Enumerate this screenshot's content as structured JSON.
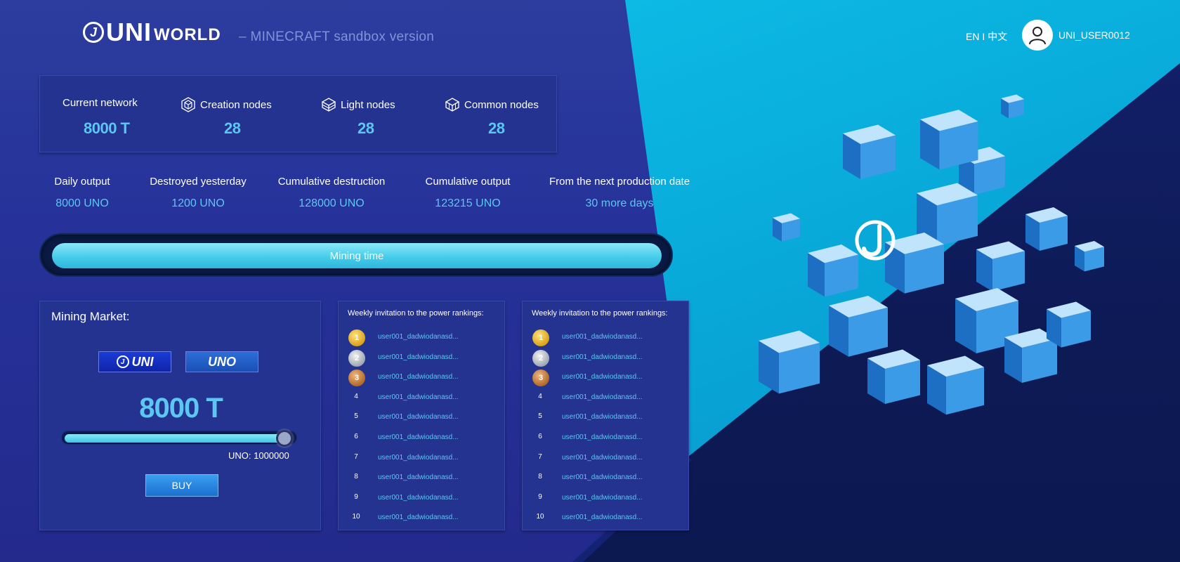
{
  "header": {
    "logo_uni": "UNI",
    "logo_world": "WORLD",
    "subtitle": "– MINECRAFT sandbox version",
    "lang_toggle": "EN I 中文",
    "username": "UNI_USER0012"
  },
  "network": [
    {
      "label": "Current network",
      "value": "8000 T",
      "icon": ""
    },
    {
      "label": "Creation nodes",
      "value": "28",
      "icon": "hexagon-cube-icon"
    },
    {
      "label": "Light nodes",
      "value": "28",
      "icon": "layered-cube-icon"
    },
    {
      "label": "Common nodes",
      "value": "28",
      "icon": "cube-icon"
    }
  ],
  "stats": [
    {
      "label": "Daily output",
      "value": "8000 UNO"
    },
    {
      "label": "Destroyed yesterday",
      "value": "1200 UNO"
    },
    {
      "label": "Cumulative destruction",
      "value": "128000 UNO"
    },
    {
      "label": "Cumulative output",
      "value": "123215 UNO"
    },
    {
      "label": "From the next production date",
      "value": "30 more days"
    }
  ],
  "mining_time": {
    "label": "Mining time"
  },
  "market": {
    "title": "Mining Market:",
    "token_uni": "UNI",
    "token_uno": "UNO",
    "amount": "8000 T",
    "slider_fraction": 0.98,
    "balance": "UNO: 1000000",
    "buy_label": "BUY"
  },
  "rankings": [
    {
      "title": "Weekly invitation to the power rankings:",
      "rows": [
        {
          "pos": "1",
          "medal": "gold",
          "user": "user001_dadwiodanasd..."
        },
        {
          "pos": "2",
          "medal": "silver",
          "user": "user001_dadwiodanasd..."
        },
        {
          "pos": "3",
          "medal": "bronze",
          "user": "user001_dadwiodanasd..."
        },
        {
          "pos": "4",
          "medal": "",
          "user": "user001_dadwiodanasd..."
        },
        {
          "pos": "5",
          "medal": "",
          "user": "user001_dadwiodanasd..."
        },
        {
          "pos": "6",
          "medal": "",
          "user": "user001_dadwiodanasd..."
        },
        {
          "pos": "7",
          "medal": "",
          "user": "user001_dadwiodanasd..."
        },
        {
          "pos": "8",
          "medal": "",
          "user": "user001_dadwiodanasd..."
        },
        {
          "pos": "9",
          "medal": "",
          "user": "user001_dadwiodanasd..."
        },
        {
          "pos": "10",
          "medal": "",
          "user": "user001_dadwiodanasd..."
        }
      ]
    },
    {
      "title": "Weekly invitation to the power rankings:",
      "rows": [
        {
          "pos": "1",
          "medal": "gold",
          "user": "user001_dadwiodanasd..."
        },
        {
          "pos": "2",
          "medal": "silver",
          "user": "user001_dadwiodanasd..."
        },
        {
          "pos": "3",
          "medal": "bronze",
          "user": "user001_dadwiodanasd..."
        },
        {
          "pos": "4",
          "medal": "",
          "user": "user001_dadwiodanasd..."
        },
        {
          "pos": "5",
          "medal": "",
          "user": "user001_dadwiodanasd..."
        },
        {
          "pos": "6",
          "medal": "",
          "user": "user001_dadwiodanasd..."
        },
        {
          "pos": "7",
          "medal": "",
          "user": "user001_dadwiodanasd..."
        },
        {
          "pos": "8",
          "medal": "",
          "user": "user001_dadwiodanasd..."
        },
        {
          "pos": "9",
          "medal": "",
          "user": "user001_dadwiodanasd..."
        },
        {
          "pos": "10",
          "medal": "",
          "user": "user001_dadwiodanasd..."
        }
      ]
    }
  ],
  "colors": {
    "accent": "#5cc7f0",
    "panel": "#243290",
    "background": "#26329a"
  }
}
